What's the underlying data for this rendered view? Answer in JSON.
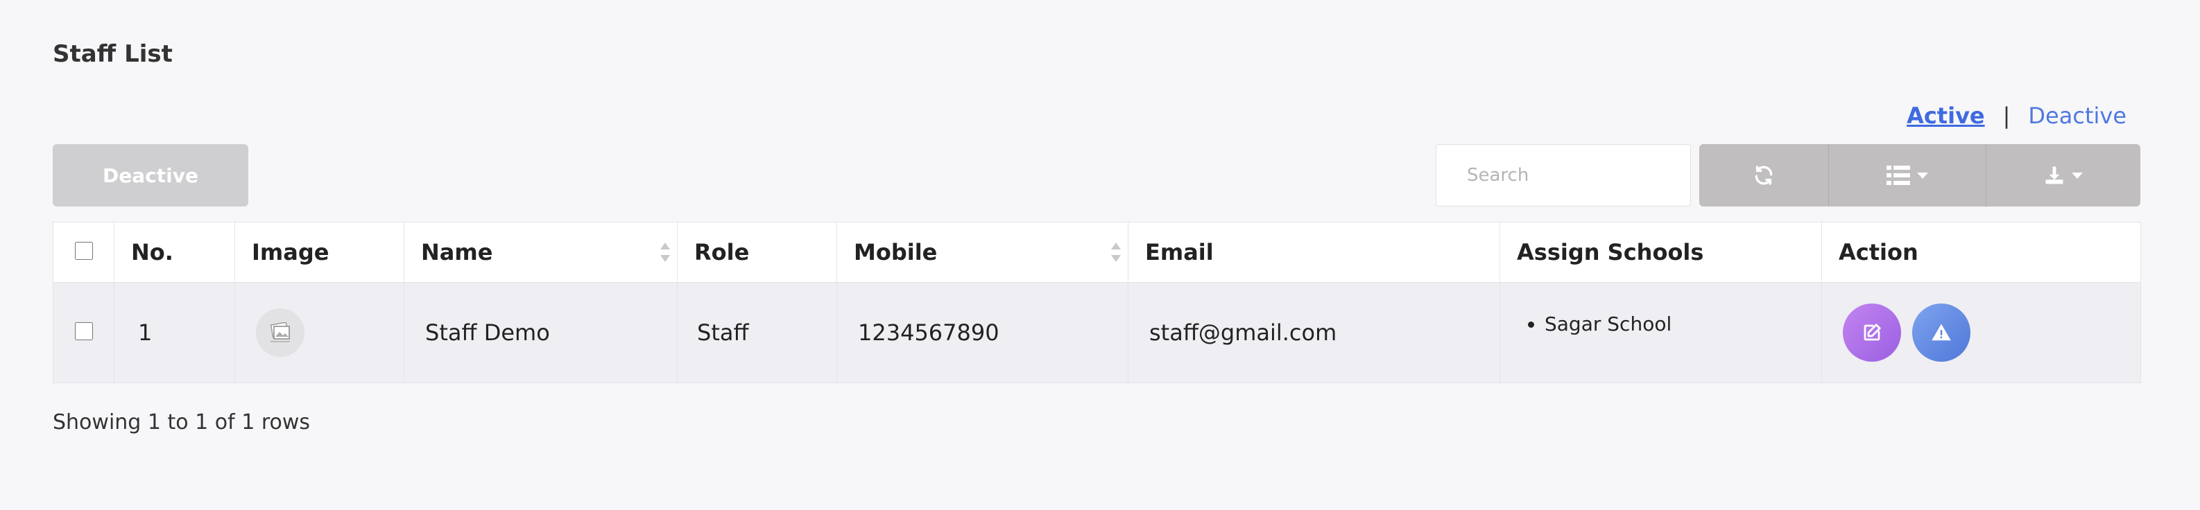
{
  "page": {
    "title": "Staff List"
  },
  "status_filter": {
    "active_label": "Active",
    "separator": "|",
    "deactive_label": "Deactive"
  },
  "toolbar": {
    "deactive_button": "Deactive",
    "search_placeholder": "Search",
    "icons": [
      "refresh-icon",
      "columns-icon",
      "export-icon"
    ]
  },
  "table": {
    "headers": {
      "no": "No.",
      "image": "Image",
      "name": "Name",
      "role": "Role",
      "mobile": "Mobile",
      "email": "Email",
      "assign_schools": "Assign Schools",
      "action": "Action"
    },
    "rows": [
      {
        "no": "1",
        "image": "no-image-available",
        "name": "Staff Demo",
        "role": "Staff",
        "mobile": "1234567890",
        "email": "staff@gmail.com",
        "schools": [
          "Sagar School"
        ]
      }
    ]
  },
  "footer": {
    "summary": "Showing 1 to 1 of 1 rows"
  },
  "colors": {
    "link": "#4f78e0",
    "toolbar_bg": "#c0bebe",
    "edit_btn": "#b575ec",
    "warn_btn": "#6a90e6"
  }
}
